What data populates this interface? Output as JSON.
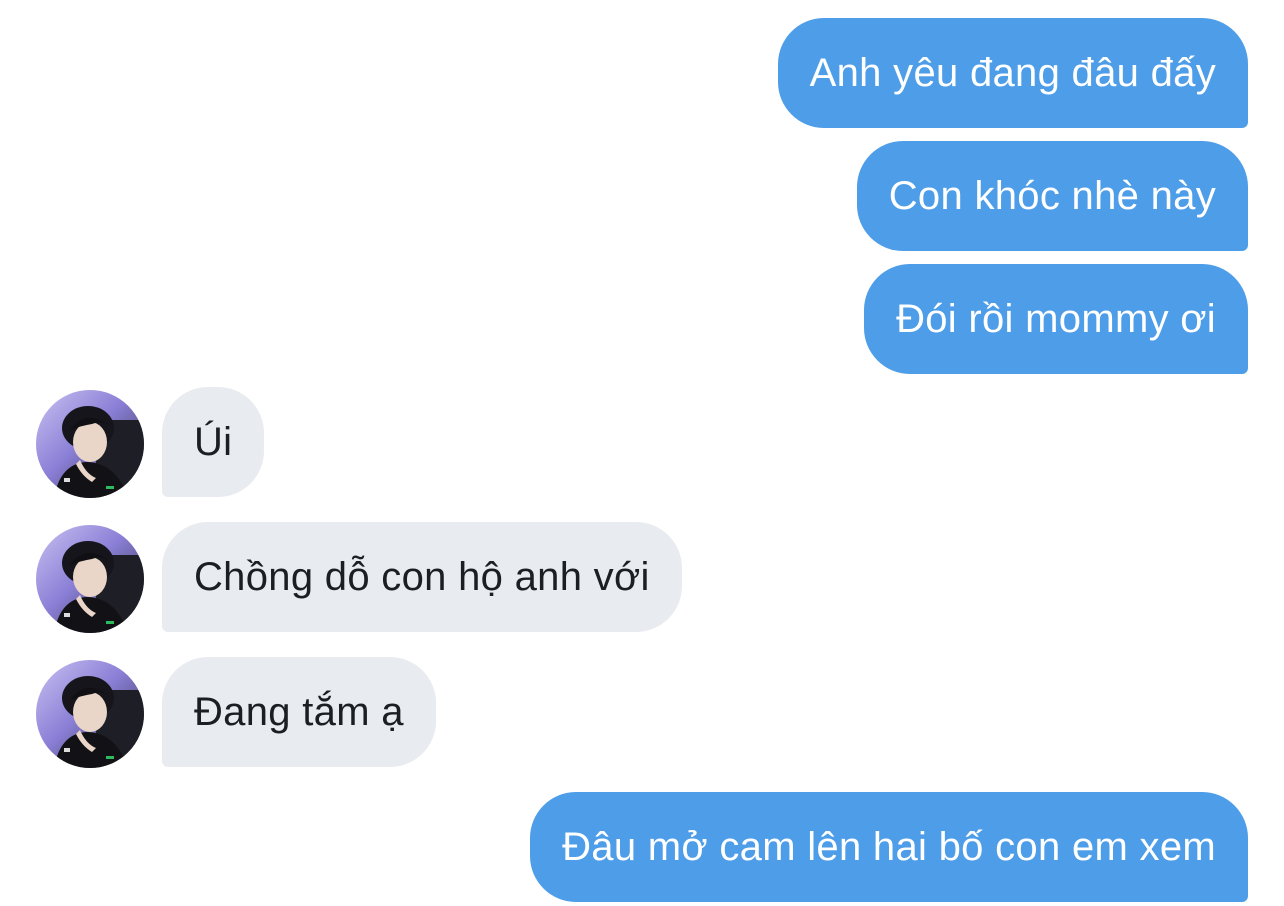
{
  "conversation": {
    "messages": [
      {
        "from": "me",
        "text": "Anh yêu đang đâu đấy"
      },
      {
        "from": "me",
        "text": "Con khóc nhè này"
      },
      {
        "from": "me",
        "text": "Đói rồi mommy ơi"
      },
      {
        "from": "them",
        "text": "Úi",
        "avatar": "profile-photo-avatar"
      },
      {
        "from": "them",
        "text": "Chồng dỗ con hộ anh với",
        "avatar": "profile-photo-avatar"
      },
      {
        "from": "them",
        "text": "Đang tắm ạ",
        "avatar": "profile-photo-avatar"
      },
      {
        "from": "me",
        "text": "Đâu mở cam lên hai bố con em xem"
      }
    ]
  },
  "colors": {
    "sent_bubble": "#4d9de8",
    "received_bubble": "#e8ebef",
    "sent_text": "#ffffff",
    "received_text": "#1b1f23",
    "background": "#ffffff"
  }
}
